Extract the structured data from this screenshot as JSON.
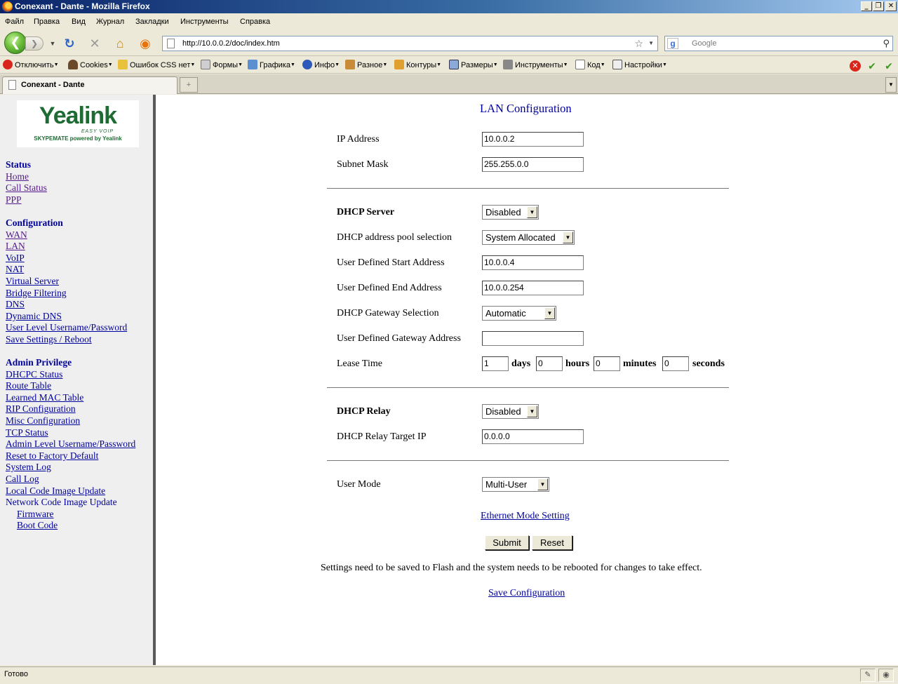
{
  "window": {
    "title": "Conexant - Dante - Mozilla Firefox"
  },
  "menu": [
    "Файл",
    "Правка",
    "Вид",
    "Журнал",
    "Закладки",
    "Инструменты",
    "Справка"
  ],
  "navbar": {
    "url": "http://10.0.0.2/doc/index.htm",
    "search_placeholder": "Google"
  },
  "devtoolbar": [
    "Отключить",
    "Cookies",
    "Ошибок CSS нет",
    "Формы",
    "Графика",
    "Инфо",
    "Разное",
    "Контуры",
    "Размеры",
    "Инструменты",
    "Код",
    "Настройки"
  ],
  "tab": {
    "label": "Conexant - Dante"
  },
  "logo": {
    "brand": "Yealink",
    "tagline": "EASY VOIP",
    "sub": "SKYPEMATE powered by Yealink"
  },
  "sidebar": {
    "status": {
      "header": "Status",
      "items": [
        "Home",
        "Call Status",
        "PPP"
      ]
    },
    "configuration": {
      "header": "Configuration",
      "items": [
        "WAN",
        "LAN",
        "VoIP",
        "NAT",
        "Virtual Server",
        "Bridge Filtering",
        "DNS",
        "Dynamic DNS",
        "User Level Username/Password",
        "Save Settings / Reboot"
      ]
    },
    "admin": {
      "header": "Admin Privilege",
      "items": [
        "DHCPC Status",
        "Route Table",
        "Learned MAC Table",
        "RIP Configuration",
        "Misc Configuration",
        "TCP Status",
        "Admin Level Username/Password",
        "Reset to Factory Default",
        "System Log",
        "Call Log",
        "Local Code Image Update"
      ],
      "network_update": "Network Code Image Update",
      "sub_items": [
        "Firmware",
        "Boot Code"
      ]
    }
  },
  "form": {
    "title": "LAN Configuration",
    "ip_address": {
      "label": "IP Address",
      "value": "10.0.0.2"
    },
    "subnet_mask": {
      "label": "Subnet Mask",
      "value": "255.255.0.0"
    },
    "dhcp_server": {
      "label": "DHCP Server",
      "value": "Disabled"
    },
    "pool_selection": {
      "label": "DHCP address pool selection",
      "value": "System Allocated"
    },
    "start_address": {
      "label": "User Defined Start Address",
      "value": "10.0.0.4"
    },
    "end_address": {
      "label": "User Defined End Address",
      "value": "10.0.0.254"
    },
    "gateway_selection": {
      "label": "DHCP Gateway Selection",
      "value": "Automatic"
    },
    "gateway_address": {
      "label": "User Defined Gateway Address",
      "value": ""
    },
    "lease_time": {
      "label": "Lease Time",
      "days": "1",
      "days_unit": "days",
      "hours": "0",
      "hours_unit": "hours",
      "minutes": "0",
      "minutes_unit": "minutes",
      "seconds": "0",
      "seconds_unit": "seconds"
    },
    "dhcp_relay": {
      "label": "DHCP Relay",
      "value": "Disabled"
    },
    "relay_target": {
      "label": "DHCP Relay Target IP",
      "value": "0.0.0.0"
    },
    "user_mode": {
      "label": "User Mode",
      "value": "Multi-User"
    },
    "ethernet_link": "Ethernet Mode Setting",
    "submit": "Submit",
    "reset": "Reset",
    "note": "Settings need to be saved to Flash and the system needs to be rebooted for changes to take effect.",
    "save_link": "Save Configuration"
  },
  "statusbar": {
    "text": "Готово"
  },
  "colors": {
    "link": "#00009c",
    "visited": "#551a8b",
    "brand": "#1f6b34"
  }
}
